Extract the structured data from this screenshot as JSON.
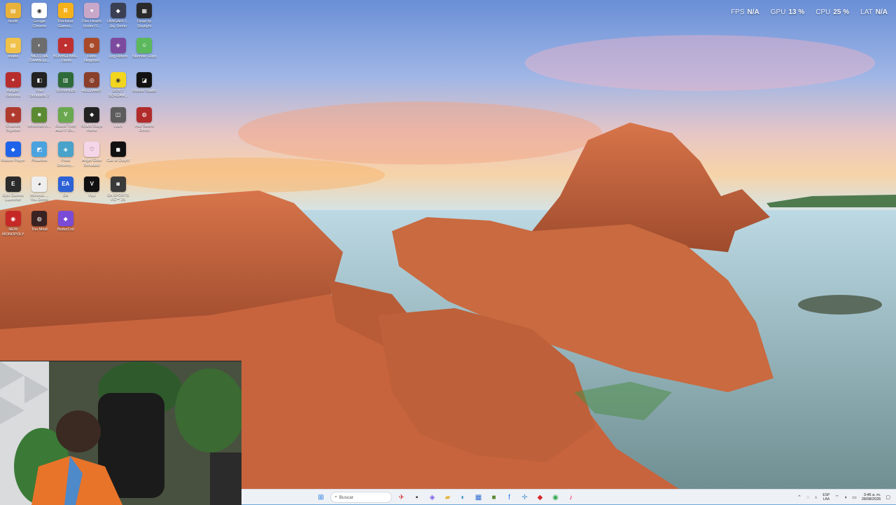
{
  "overlay": {
    "fps_label": "FPS",
    "fps_value": "N/A",
    "gpu_label": "GPU",
    "gpu_value": "13 %",
    "cpu_label": "CPU",
    "cpu_value": "25 %",
    "lat_label": "LAT",
    "lat_value": "N/A"
  },
  "desktop_icons": [
    {
      "label": "fiveM",
      "color": "#e8b23a",
      "glyph": "▤"
    },
    {
      "label": "Google Chrome",
      "color": "#ffffff",
      "glyph": "◉"
    },
    {
      "label": "Rockstar Games...",
      "color": "#f6b21b",
      "glyph": "R"
    },
    {
      "label": "Five Hearts Under O...",
      "color": "#c9a7c9",
      "glyph": "♥"
    },
    {
      "label": "UMIGARI I... Jay Demo",
      "color": "#3b3f52",
      "glyph": "◆"
    },
    {
      "label": "Dead by Daylight",
      "color": "#2a2a2a",
      "glyph": "▦"
    },
    {
      "label": "noabs",
      "color": "#f0c24a",
      "glyph": "▤"
    },
    {
      "label": "MECCHA CHAMELE...",
      "color": "#6d6d6d",
      "glyph": "◐"
    },
    {
      "label": "BOMBERMA... Demo",
      "color": "#c03030",
      "glyph": "●"
    },
    {
      "label": "Hello Neighbor",
      "color": "#a84a2a",
      "glyph": "◍"
    },
    {
      "label": "Log Riders",
      "color": "#7c4a9e",
      "glyph": "◈"
    },
    {
      "label": "Stumble Guys",
      "color": "#5cb85c",
      "glyph": "☺"
    },
    {
      "label": "Burglin' Gnomes",
      "color": "#b72d2d",
      "glyph": "✦"
    },
    {
      "label": "Thief Simulator 2",
      "color": "#222222",
      "glyph": "◧"
    },
    {
      "label": "TERMINUS",
      "color": "#2f6b3a",
      "glyph": "▥"
    },
    {
      "label": "HELLMART",
      "color": "#8a3f2a",
      "glyph": "◎"
    },
    {
      "label": "DON'T SCREAM...",
      "color": "#f2d51e",
      "glyph": "◉"
    },
    {
      "label": "Roblox Studio",
      "color": "#111111",
      "glyph": "◪"
    },
    {
      "label": "Chained Together",
      "color": "#b03a2e",
      "glyph": "◈"
    },
    {
      "label": "Minecraft in...",
      "color": "#5b8a33",
      "glyph": "■"
    },
    {
      "label": "Grand Theft Auto V En...",
      "color": "#6aa84f",
      "glyph": "V"
    },
    {
      "label": "Grand Stays Home",
      "color": "#222222",
      "glyph": "◆"
    },
    {
      "label": "Liars",
      "color": "#5c5c5c",
      "glyph": "◫"
    },
    {
      "label": "Half Sword Demo",
      "color": "#b12b2b",
      "glyph": "◍"
    },
    {
      "label": "Roblox Player",
      "color": "#1e63e9",
      "glyph": "◆"
    },
    {
      "label": "Polarities",
      "color": "#4aa3df",
      "glyph": "◩"
    },
    {
      "label": "Food Delivery...",
      "color": "#48a2c9",
      "glyph": "◈"
    },
    {
      "label": "Angel Glow Simulator",
      "color": "#f5d6e8",
      "glyph": "♡"
    },
    {
      "label": "Call of Duty®",
      "color": "#111111",
      "glyph": "◼"
    },
    {
      "label": "",
      "color": "",
      "glyph": ""
    },
    {
      "label": "Epic Games Launcher",
      "color": "#2b2b2b",
      "glyph": "E"
    },
    {
      "label": "Mimesis ... You Demo",
      "color": "#eeeeee",
      "glyph": "◕"
    },
    {
      "label": "EA",
      "color": "#2d62d6",
      "glyph": "EA"
    },
    {
      "label": "Vigil",
      "color": "#111111",
      "glyph": "V"
    },
    {
      "label": "EA SPORTS FC™ 25",
      "color": "#3a3a3a",
      "glyph": "◙"
    },
    {
      "label": "",
      "color": "",
      "glyph": ""
    },
    {
      "label": "NEW MONOPOLY",
      "color": "#c62828",
      "glyph": "◉"
    },
    {
      "label": "The Mind",
      "color": "#3a2222",
      "glyph": "◍"
    },
    {
      "label": "BetterCrd",
      "color": "#7a4bd6",
      "glyph": "◆"
    }
  ],
  "taskbar": {
    "search_placeholder": "Buscar",
    "apps": [
      {
        "name": "windows-start-icon",
        "glyph": "⊞",
        "color": "#1a73e8"
      },
      {
        "name": "search-icon"
      },
      {
        "name": "widget-icon",
        "glyph": "✈",
        "color": "#d23a3a"
      },
      {
        "name": "terminal-icon",
        "glyph": "▪",
        "color": "#333333"
      },
      {
        "name": "copilot-icon",
        "glyph": "◈",
        "color": "#7a5ae6"
      },
      {
        "name": "file-explorer-icon",
        "glyph": "▰",
        "color": "#e6b43a"
      },
      {
        "name": "edge-icon",
        "glyph": "◐",
        "color": "#1e88c8"
      },
      {
        "name": "store-icon",
        "glyph": "▦",
        "color": "#2f6fd1"
      },
      {
        "name": "minecraft-icon",
        "glyph": "■",
        "color": "#5b8a33"
      },
      {
        "name": "facebook-icon",
        "glyph": "f",
        "color": "#1877f2"
      },
      {
        "name": "shield-icon",
        "glyph": "✛",
        "color": "#5b9bd5"
      },
      {
        "name": "roblox-icon",
        "glyph": "◆",
        "color": "#d62828"
      },
      {
        "name": "chrome-icon",
        "glyph": "◉",
        "color": "#34a853"
      },
      {
        "name": "tiktok-icon",
        "glyph": "♪",
        "color": "#ee1d52"
      }
    ],
    "tray": {
      "lang_line1": "ESP",
      "lang_line2": "LAA",
      "time": "3:46 a. m.",
      "date": "28/08/2026"
    }
  }
}
